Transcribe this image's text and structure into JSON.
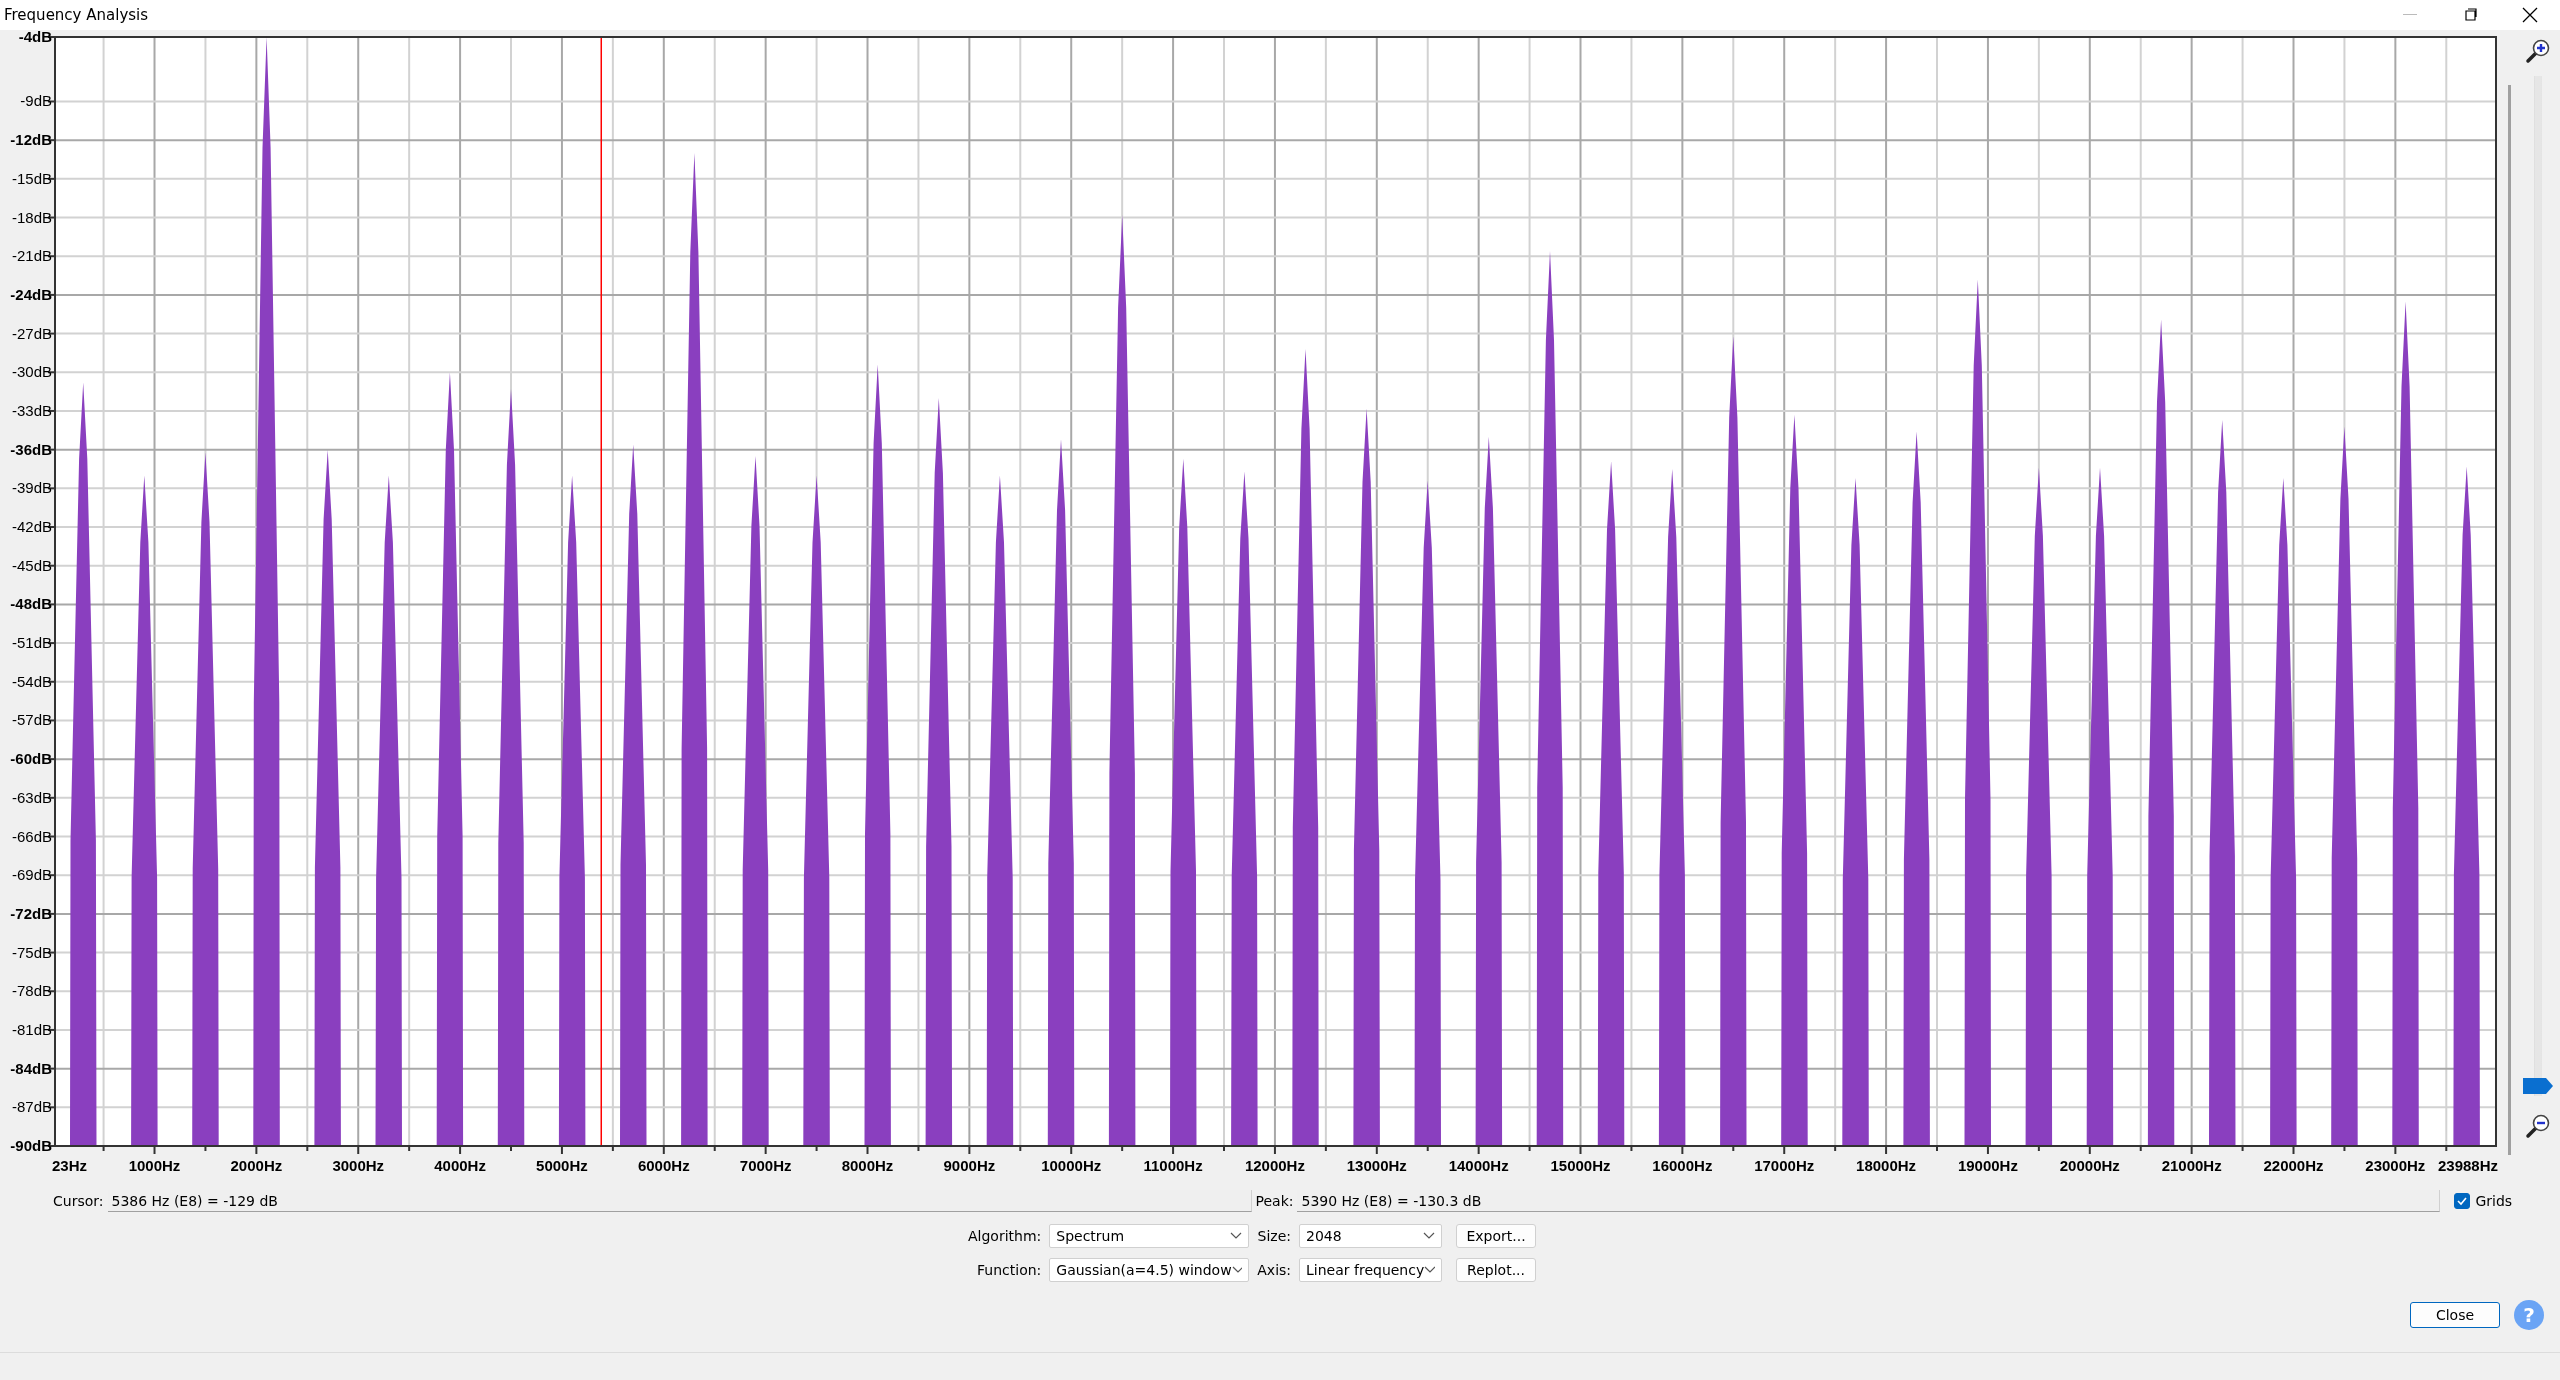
{
  "window": {
    "title": "Frequency Analysis"
  },
  "chart": {
    "chart_data": {
      "type": "area",
      "grid": true,
      "x": [
        170,
        175,
        260,
        300,
        340,
        425,
        430,
        770,
        775,
        860,
        900,
        940,
        1025,
        1030,
        1370,
        1375,
        1460,
        1500,
        1540,
        1625,
        1630,
        1970,
        1975,
        2060,
        2100,
        2140,
        2225,
        2230,
        2570,
        2575,
        2660,
        2700,
        2740,
        2825,
        2830,
        3170,
        3175,
        3260,
        3300,
        3340,
        3425,
        3430,
        3770,
        3775,
        3860,
        3900,
        3940,
        4025,
        4030,
        4370,
        4375,
        4460,
        4500,
        4540,
        4625,
        4630,
        4970,
        4975,
        5060,
        5100,
        5140,
        5225,
        5230,
        5570,
        5575,
        5660,
        5700,
        5740,
        5825,
        5830,
        6170,
        6175,
        6260,
        6300,
        6340,
        6425,
        6430,
        6770,
        6775,
        6860,
        6900,
        6940,
        7025,
        7030,
        7370,
        7375,
        7460,
        7500,
        7540,
        7625,
        7630,
        7970,
        7975,
        8060,
        8100,
        8140,
        8225,
        8230,
        8570,
        8575,
        8660,
        8700,
        8740,
        8825,
        8830,
        9170,
        9175,
        9260,
        9300,
        9340,
        9425,
        9430,
        9770,
        9775,
        9860,
        9900,
        9940,
        10025,
        10030,
        10370,
        10375,
        10460,
        10500,
        10540,
        10625,
        10630,
        10970,
        10975,
        11060,
        11100,
        11140,
        11225,
        11230,
        11570,
        11575,
        11660,
        11700,
        11740,
        11825,
        11830,
        12170,
        12175,
        12260,
        12300,
        12340,
        12425,
        12430,
        12770,
        12775,
        12860,
        12900,
        12940,
        13025,
        13030,
        13370,
        13375,
        13460,
        13500,
        13540,
        13625,
        13630,
        13970,
        13975,
        14060,
        14100,
        14140,
        14225,
        14230,
        14570,
        14575,
        14660,
        14700,
        14740,
        14825,
        14830,
        15170,
        15175,
        15260,
        15300,
        15340,
        15425,
        15430,
        15770,
        15775,
        15860,
        15900,
        15940,
        16025,
        16030,
        16370,
        16375,
        16460,
        16500,
        16540,
        16625,
        16630,
        16970,
        16975,
        17060,
        17100,
        17140,
        17225,
        17230,
        17570,
        17575,
        17660,
        17700,
        17740,
        17825,
        17830,
        18170,
        18175,
        18260,
        18300,
        18340,
        18425,
        18430,
        18770,
        18775,
        18860,
        18900,
        18940,
        19025,
        19030,
        19370,
        19375,
        19460,
        19500,
        19540,
        19625,
        19630,
        19970,
        19975,
        20060,
        20100,
        20140,
        20225,
        20230,
        20570,
        20575,
        20660,
        20700,
        20740,
        20825,
        20830,
        21170,
        21175,
        21260,
        21300,
        21340,
        21425,
        21430,
        21770,
        21775,
        21860,
        21900,
        21940,
        22025,
        22030,
        22370,
        22375,
        22460,
        22500,
        22540,
        22625,
        22630,
        22970,
        22975,
        23060,
        23100,
        23140,
        23225,
        23230,
        23570,
        23575,
        23660,
        23700,
        23740,
        23825,
        23830
      ],
      "series": [
        {
          "color": "#8a3fbf",
          "values": [
            -90,
            -66.3,
            -36.7,
            -30.8,
            -36.7,
            -66.3,
            -90,
            -90,
            -69.2,
            -43.2,
            -38,
            -43.2,
            -69.2,
            -90,
            -90,
            -68.5,
            -41.6,
            -36.2,
            -41.6,
            -68.5,
            -90,
            -90,
            -55.6,
            -12.6,
            -4,
            -12.6,
            -55.6,
            -90,
            -90,
            -68.4,
            -41.4,
            -36,
            -41.4,
            -68.4,
            -90,
            -90,
            -69.2,
            -43.2,
            -38,
            -43.2,
            -69.2,
            -90,
            -90,
            -66,
            -36,
            -30,
            -36,
            -66,
            -90,
            -90,
            -66.5,
            -37.2,
            -31.3,
            -37.2,
            -66.5,
            -90,
            -90,
            -69.2,
            -43.2,
            -38,
            -43.2,
            -69.2,
            -90,
            -90,
            -68.2,
            -41,
            -35.6,
            -41,
            -68.2,
            -90,
            -90,
            -59.2,
            -20.7,
            -13,
            -20.7,
            -59.2,
            -90,
            -90,
            -68.6,
            -41.9,
            -36.5,
            -41.9,
            -68.6,
            -90,
            -90,
            -69.2,
            -43.2,
            -38,
            -43.2,
            -69.2,
            -90,
            -90,
            -65.8,
            -35.5,
            -29.4,
            -35.5,
            -65.8,
            -90,
            -90,
            -66.8,
            -37.8,
            -32,
            -37.8,
            -66.8,
            -90,
            -90,
            -69.2,
            -43.2,
            -38,
            -43.2,
            -69.2,
            -90,
            -90,
            -68.1,
            -40.7,
            -35.2,
            -40.7,
            -68.1,
            -90,
            -90,
            -61.1,
            -25,
            -17.8,
            -25,
            -61.1,
            -90,
            -90,
            -68.7,
            -42,
            -36.7,
            -42,
            -68.7,
            -90,
            -90,
            -69.1,
            -42.9,
            -37.7,
            -42.9,
            -69.1,
            -90,
            -90,
            -65.3,
            -34.4,
            -28.2,
            -34.4,
            -65.3,
            -90,
            -90,
            -67.1,
            -38.5,
            -32.8,
            -38.5,
            -67.1,
            -90,
            -90,
            -69.4,
            -43.6,
            -38.4,
            -43.6,
            -69.4,
            -90,
            -90,
            -68,
            -40.5,
            -35,
            -40.5,
            -68,
            -90,
            -90,
            -62.2,
            -27.5,
            -20.6,
            -27.5,
            -62.2,
            -90,
            -90,
            -68.8,
            -42.2,
            -36.9,
            -42.2,
            -68.8,
            -90,
            -90,
            -69,
            -42.8,
            -37.5,
            -42.8,
            -69,
            -90,
            -90,
            -64.9,
            -33.5,
            -27.2,
            -33.5,
            -64.9,
            -90,
            -90,
            -67.3,
            -39,
            -33.3,
            -39,
            -67.3,
            -90,
            -90,
            -69.3,
            -43.4,
            -38.2,
            -43.4,
            -69.3,
            -90,
            -90,
            -67.8,
            -40.1,
            -34.6,
            -40.1,
            -67.8,
            -90,
            -90,
            -63.1,
            -29.5,
            -22.8,
            -29.5,
            -63.1,
            -90,
            -90,
            -69,
            -42.7,
            -37.4,
            -42.7,
            -69,
            -90,
            -90,
            -69,
            -42.7,
            -37.4,
            -42.7,
            -69,
            -90,
            -90,
            -64.4,
            -32.3,
            -25.9,
            -32.3,
            -64.4,
            -90,
            -90,
            -67.5,
            -39.3,
            -33.7,
            -39.3,
            -67.5,
            -90,
            -90,
            -69.3,
            -43.4,
            -38.2,
            -43.4,
            -69.3,
            -90,
            -90,
            -67.7,
            -39.8,
            -34.2,
            -39.8,
            -67.7,
            -90,
            -90,
            -63.8,
            -31.1,
            -24.5,
            -31.1,
            -63.8,
            -90,
            -90,
            -68.9,
            -42.6,
            -37.3,
            -42.6,
            -68.9,
            -90
          ]
        }
      ],
      "xlim": [
        23,
        23988
      ],
      "ylim": [
        -90,
        -4
      ],
      "xticks": [
        {
          "value": 23,
          "label": "23Hz"
        },
        {
          "value": 1000,
          "label": "1000Hz"
        },
        {
          "value": 2000,
          "label": "2000Hz"
        },
        {
          "value": 3000,
          "label": "3000Hz"
        },
        {
          "value": 4000,
          "label": "4000Hz"
        },
        {
          "value": 5000,
          "label": "5000Hz"
        },
        {
          "value": 6000,
          "label": "6000Hz"
        },
        {
          "value": 7000,
          "label": "7000Hz"
        },
        {
          "value": 8000,
          "label": "8000Hz"
        },
        {
          "value": 9000,
          "label": "9000Hz"
        },
        {
          "value": 10000,
          "label": "10000Hz"
        },
        {
          "value": 11000,
          "label": "11000Hz"
        },
        {
          "value": 12000,
          "label": "12000Hz"
        },
        {
          "value": 13000,
          "label": "13000Hz"
        },
        {
          "value": 14000,
          "label": "14000Hz"
        },
        {
          "value": 15000,
          "label": "15000Hz"
        },
        {
          "value": 16000,
          "label": "16000Hz"
        },
        {
          "value": 17000,
          "label": "17000Hz"
        },
        {
          "value": 18000,
          "label": "18000Hz"
        },
        {
          "value": 19000,
          "label": "19000Hz"
        },
        {
          "value": 20000,
          "label": "20000Hz"
        },
        {
          "value": 21000,
          "label": "21000Hz"
        },
        {
          "value": 22000,
          "label": "22000Hz"
        },
        {
          "value": 23000,
          "label": "23000Hz"
        },
        {
          "value": 23988,
          "label": "23988Hz"
        }
      ],
      "yticks": [
        {
          "value": -4,
          "label": "-4dB"
        },
        {
          "value": -9,
          "label": "-9dB"
        },
        {
          "value": -12,
          "label": "-12dB"
        },
        {
          "value": -15,
          "label": "-15dB"
        },
        {
          "value": -18,
          "label": "-18dB"
        },
        {
          "value": -21,
          "label": "-21dB"
        },
        {
          "value": -24,
          "label": "-24dB"
        },
        {
          "value": -27,
          "label": "-27dB"
        },
        {
          "value": -30,
          "label": "-30dB"
        },
        {
          "value": -33,
          "label": "-33dB"
        },
        {
          "value": -36,
          "label": "-36dB"
        },
        {
          "value": -39,
          "label": "-39dB"
        },
        {
          "value": -42,
          "label": "-42dB"
        },
        {
          "value": -45,
          "label": "-45dB"
        },
        {
          "value": -48,
          "label": "-48dB"
        },
        {
          "value": -51,
          "label": "-51dB"
        },
        {
          "value": -54,
          "label": "-54dB"
        },
        {
          "value": -57,
          "label": "-57dB"
        },
        {
          "value": -60,
          "label": "-60dB"
        },
        {
          "value": -63,
          "label": "-63dB"
        },
        {
          "value": -66,
          "label": "-66dB"
        },
        {
          "value": -69,
          "label": "-69dB"
        },
        {
          "value": -72,
          "label": "-72dB"
        },
        {
          "value": -75,
          "label": "-75dB"
        },
        {
          "value": -78,
          "label": "-78dB"
        },
        {
          "value": -81,
          "label": "-81dB"
        },
        {
          "value": -84,
          "label": "-84dB"
        },
        {
          "value": -87,
          "label": "-87dB"
        },
        {
          "value": -90,
          "label": "-90dB"
        }
      ],
      "ref_lines": [
        {
          "axis": "x",
          "value": 5386,
          "color": "#ff0000"
        }
      ]
    }
  },
  "zoom_slider": {
    "level": 0.01
  },
  "cursor": {
    "label": "Cursor:",
    "value": "5386 Hz (E8) = -129 dB"
  },
  "peak": {
    "label": "Peak:",
    "value": "5390 Hz (E8) = -130.3 dB"
  },
  "grids": {
    "label": "Grids",
    "checked": true
  },
  "settings_rows": [
    {
      "fields": [
        {
          "label": "Algorithm:",
          "value": "Spectrum"
        },
        {
          "label": "Size:",
          "value": "2048"
        }
      ],
      "button": "Export..."
    },
    {
      "fields": [
        {
          "label": "Function:",
          "value": "Gaussian(a=4.5) window"
        },
        {
          "label": "Axis:",
          "value": "Linear frequency"
        }
      ],
      "button": "Replot..."
    }
  ],
  "close_button": "Close",
  "help_button": "?"
}
